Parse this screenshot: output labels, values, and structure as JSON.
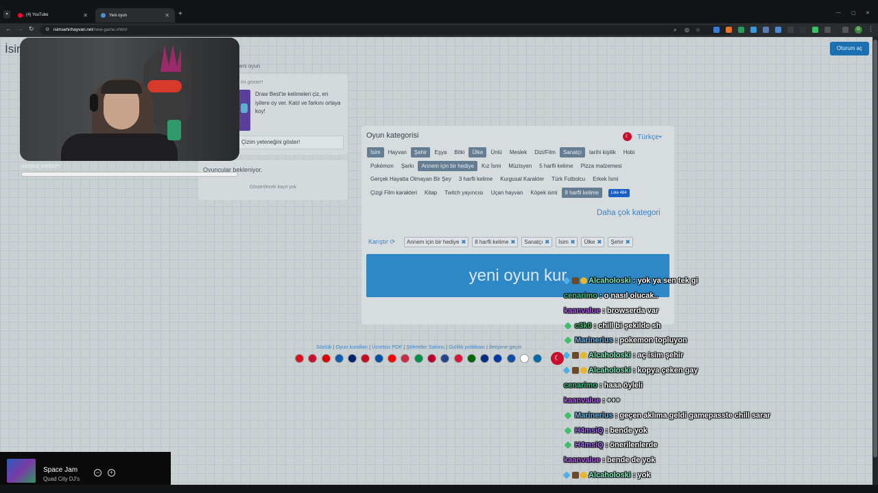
{
  "browser": {
    "tabs": [
      {
        "title": "(4) YouTube",
        "favicon_color": "#ff0033"
      },
      {
        "title": "Yeni oyun",
        "favicon_color": "#4a90d9"
      }
    ],
    "url_host": "isimsehirhayvan.net",
    "url_path": "/new-game.xhtml",
    "profile_initial": "G"
  },
  "site": {
    "logo": "İsim",
    "login_label": "Oturum aç",
    "side_title": "eni oyun",
    "draw_card": {
      "head": "ini göster!",
      "description": "Draw Best'te kelimeleri çiz, en iyilere oy ver. Katıl ve farkını ortaya koy!",
      "show_button": "Çizim yeteneğini göster!"
    },
    "players": {
      "title": "Oyuncular bekleniyor.",
      "empty": "Gösterilecek kayıt yok"
    }
  },
  "category": {
    "title": "Oyun kategorisi",
    "language": "Türkçe",
    "rows": [
      [
        {
          "label": "İsim",
          "selected": true
        },
        {
          "label": "Hayvan",
          "selected": false
        },
        {
          "label": "Şehir",
          "selected": true
        },
        {
          "label": "Eşya",
          "selected": false
        },
        {
          "label": "Bitki",
          "selected": false
        },
        {
          "label": "Ülke",
          "selected": true
        },
        {
          "label": "Ünlü",
          "selected": false
        },
        {
          "label": "Meslek",
          "selected": false
        },
        {
          "label": "Dizi/Film",
          "selected": false
        },
        {
          "label": "Sanatçı",
          "selected": true
        },
        {
          "label": "tarihi kişilik",
          "selected": false
        },
        {
          "label": "Hobi",
          "selected": false
        }
      ],
      [
        {
          "label": "Pokémon",
          "selected": false
        },
        {
          "label": "Şarkı",
          "selected": false
        },
        {
          "label": "Annem için bir hediye",
          "selected": true
        },
        {
          "label": "Kız İsmi",
          "selected": false
        },
        {
          "label": "Müzisyen",
          "selected": false
        },
        {
          "label": "5 harfli kelime",
          "selected": false
        },
        {
          "label": "Pizza malzemesi",
          "selected": false
        }
      ],
      [
        {
          "label": "Gerçek Hayatta Olmayan Bir Şey",
          "selected": false
        },
        {
          "label": "3 harfli kelime",
          "selected": false
        },
        {
          "label": "Kurgusal Karakter",
          "selected": false
        },
        {
          "label": "Türk Futbolcu",
          "selected": false
        },
        {
          "label": "Erkek İsmi",
          "selected": false
        }
      ],
      [
        {
          "label": "Çizgi Film karakteri",
          "selected": false
        },
        {
          "label": "Kitap",
          "selected": false
        },
        {
          "label": "Twitch yayıncısı",
          "selected": false
        },
        {
          "label": "Uçan hayvan",
          "selected": false
        },
        {
          "label": "Köpek ismi",
          "selected": false
        },
        {
          "label": "8 harfli kelime",
          "selected": true
        }
      ]
    ],
    "fb_like": "Like 484",
    "more": "Daha çok kategori",
    "shuffle": "Karıştır",
    "selected_tags": [
      "Annem için bir hediye",
      "8 harfli kelime",
      "Sanatçı",
      "İsim",
      "Ülke",
      "Şehir"
    ],
    "new_game": "yeni oyun kur"
  },
  "footer": {
    "links": [
      "Sözlük",
      "Oyun kuralları",
      "Ücretsiz PDF",
      "Şöhretler Salonu",
      "Gizlilik politikası",
      "İletişime geçin"
    ],
    "flag_colors": [
      "#d7141a",
      "#c8102e",
      "#dd0000",
      "#0d5eaf",
      "#012169",
      "#c60b1e",
      "#0055a4",
      "#ff0000",
      "#cd2a3e",
      "#009246",
      "#bc002d",
      "#21468b",
      "#dc143c",
      "#006600",
      "#002b7f",
      "#0039a6",
      "#0b4ea2",
      "#ffffff",
      "#006aa7"
    ]
  },
  "stream": {
    "sub_goal_label": "ABONE HEDEFİ",
    "sub_goal_progress": 1.0,
    "song": "Space Jam",
    "artist": "Quad City DJ's"
  },
  "chat": [
    {
      "user": "Alcaholoski",
      "text": ": yok ya sen tek gi",
      "color": "#7ff0c0",
      "badges": [
        "diamond",
        "box",
        "coin"
      ]
    },
    {
      "user": "cenarimo",
      "text": ": o nasıl olucak..",
      "color": "#39c28a",
      "badges": []
    },
    {
      "user": "kaanvalue",
      "text": ": browserda var",
      "color": "#b15cf0",
      "badges": []
    },
    {
      "user": "c3k0",
      "text": ": chill bi şekilde sh",
      "color": "#3ec06a",
      "badges": [
        "green"
      ]
    },
    {
      "user": "Marinerius",
      "text": ": pokemon topluyon",
      "color": "#6fb7e8",
      "badges": [
        "green"
      ]
    },
    {
      "user": "Alcaholoski",
      "text": ": aç isim şehir",
      "color": "#7ff0c0",
      "badges": [
        "diamond",
        "box",
        "coin"
      ]
    },
    {
      "user": "Alcaholoski",
      "text": ": kopya çeken gay",
      "color": "#7ff0c0",
      "badges": [
        "diamond",
        "box",
        "coin"
      ]
    },
    {
      "user": "cenarimo",
      "text": ": haaa öyleli",
      "color": "#39c28a",
      "badges": []
    },
    {
      "user": "kaanvalue",
      "text": ": +++",
      "color": "#b15cf0",
      "badges": []
    },
    {
      "user": "Marinerius",
      "text": ": geçen aklıma geldi gamepasste chill sarar",
      "color": "#6fb7e8",
      "badges": [
        "green"
      ]
    },
    {
      "user": "H4msiQ",
      "text": ": bende yok",
      "color": "#a070f0",
      "badges": [
        "green"
      ]
    },
    {
      "user": "H4msiQ",
      "text": ": önerilenlerde",
      "color": "#a070f0",
      "badges": [
        "green"
      ]
    },
    {
      "user": "kaanvalue",
      "text": ": bende de yok",
      "color": "#b15cf0",
      "badges": []
    },
    {
      "user": "Alcaholoski",
      "text": ": yok",
      "color": "#7ff0c0",
      "badges": [
        "diamond",
        "box",
        "coin"
      ]
    }
  ]
}
